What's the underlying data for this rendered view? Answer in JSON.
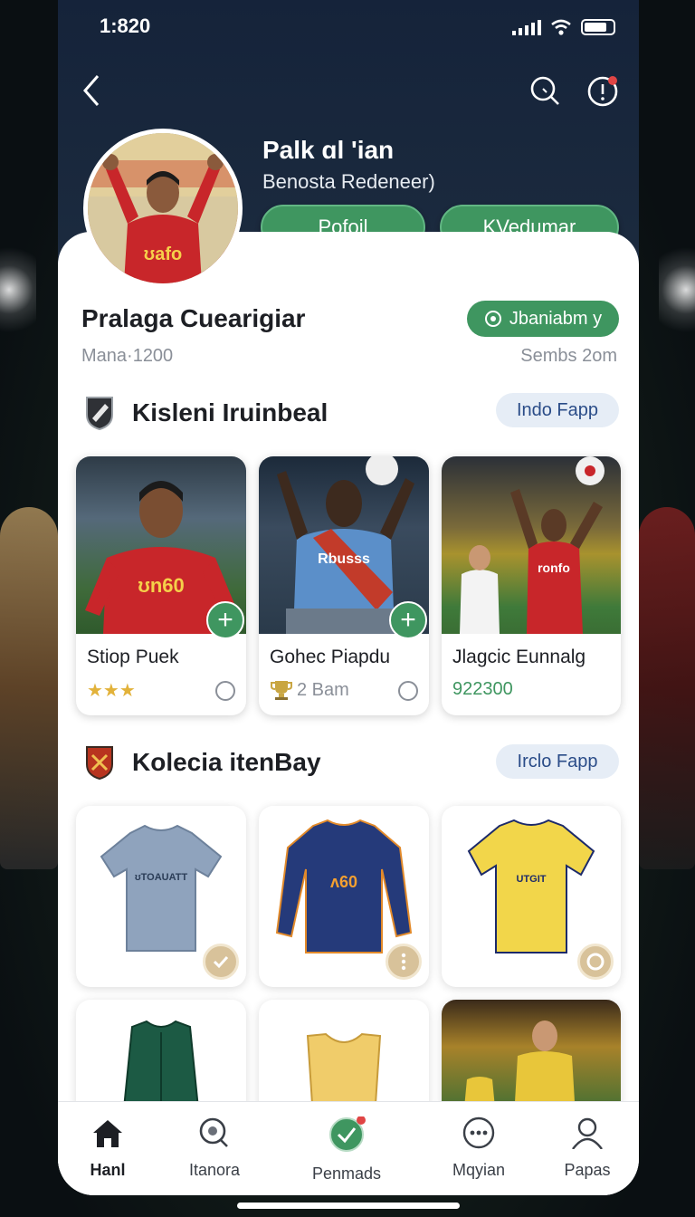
{
  "status_bar": {
    "time": "1:820"
  },
  "profile": {
    "name": "Palk ɑl 'ian",
    "subtitle": "Benosta Redeneer)",
    "btn_primary": "Pofoil",
    "btn_secondary": "KVedumar"
  },
  "summary": {
    "title": "Pralaga Cuearigiar",
    "meta_left": "Mana·1200",
    "badge": "Jbaniabm y",
    "meta_right": "Sembs 2om"
  },
  "section_players": {
    "title": "Kisleni Iruinbeal",
    "link": "Indo Fapp",
    "cards": [
      {
        "name": "Stiop Puek",
        "meta": "★★★",
        "kind": "stars",
        "jersey_text": "ʊn60"
      },
      {
        "name": "Gohec Piapdu",
        "meta": "2 Bam",
        "kind": "trophy",
        "jersey_text": "Rbusss"
      },
      {
        "name": "Jlagcic Eunnalg",
        "meta": "922300",
        "kind": "number",
        "jersey_text": "ronfo"
      }
    ]
  },
  "section_kits": {
    "title": "Kolecia itenBay",
    "link": "Irclo Fapp",
    "kits": [
      {
        "label": "kit-grey",
        "shirt_text": "ʊTOAUATT"
      },
      {
        "label": "kit-navy",
        "shirt_text": "ʌ60"
      },
      {
        "label": "kit-yellow",
        "shirt_text": "UTGIT"
      }
    ]
  },
  "bottom_nav": {
    "items": [
      {
        "label": "Hanl",
        "icon": "home-icon"
      },
      {
        "label": "Itanora",
        "icon": "search-icon"
      },
      {
        "label": "Penmads",
        "icon": "check-icon"
      },
      {
        "label": "Mqyian",
        "icon": "more-icon"
      },
      {
        "label": "Papas",
        "icon": "profile-icon"
      }
    ]
  },
  "colors": {
    "accent": "#3f9660",
    "card_bg": "#ffffff",
    "header_bg": "#1b2a3e",
    "link_bg": "#e6edf6"
  }
}
